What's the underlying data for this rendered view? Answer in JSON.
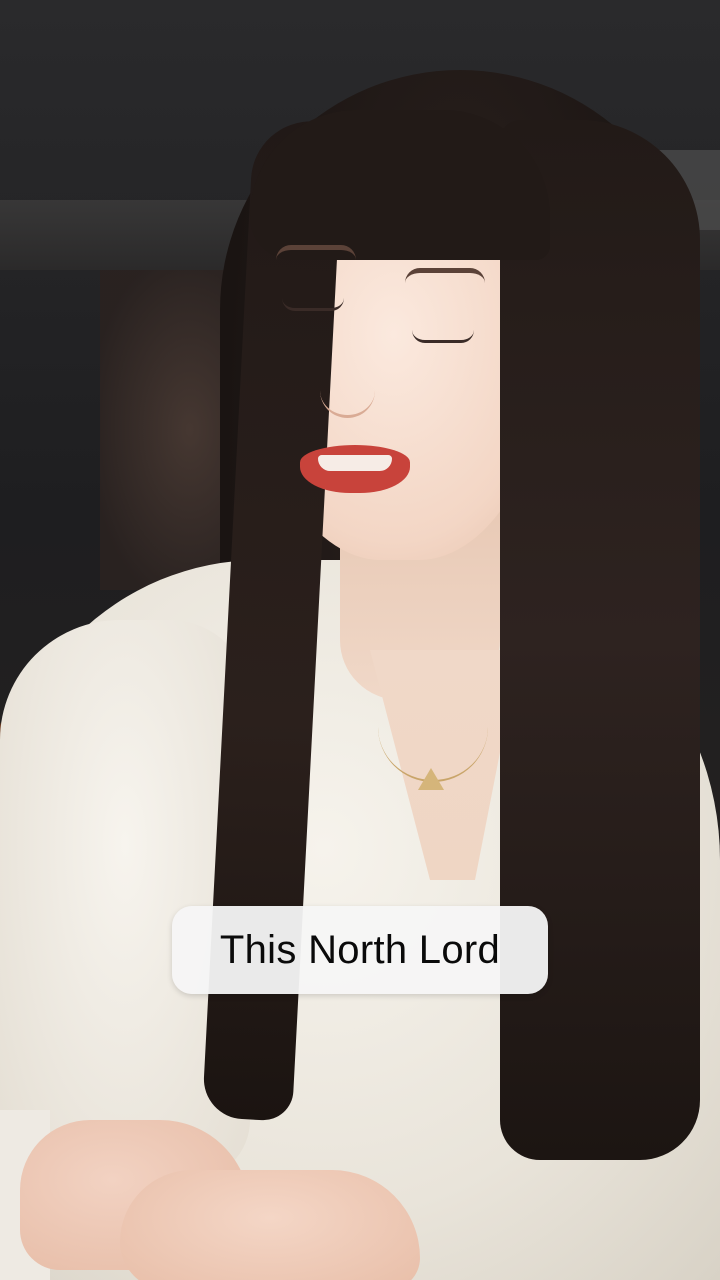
{
  "caption": {
    "text": "This North Lord"
  },
  "colors": {
    "caption_background": "#f5f5f5",
    "caption_text": "#0a0a0a",
    "sweater": "#f3efe7",
    "hair": "#221a17",
    "lips": "#c8433b"
  }
}
